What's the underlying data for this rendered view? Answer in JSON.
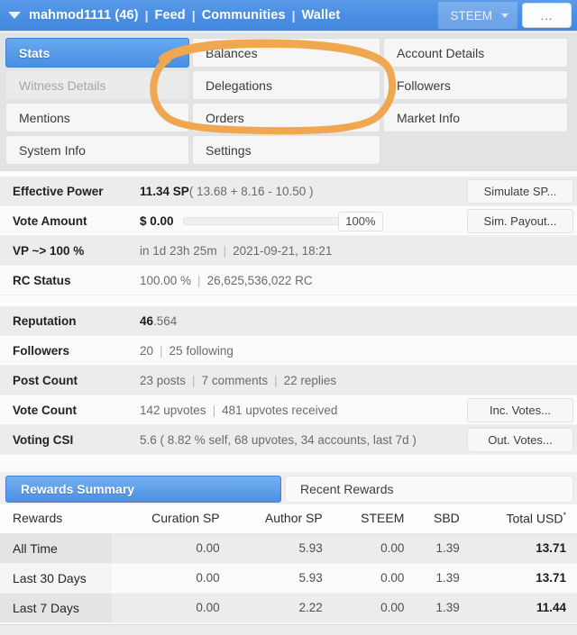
{
  "navbar": {
    "caret_icon": "caret-down-icon",
    "username": "mahmod1111 (46)",
    "links": [
      "Feed",
      "Communities",
      "Wallet"
    ],
    "separator": "|",
    "currency": "STEEM",
    "currency_caret_icon": "caret-down-icon",
    "more_button": "...",
    "accent": "#4a8fe3"
  },
  "tabs": [
    {
      "label": "Stats",
      "state": "active"
    },
    {
      "label": "Balances",
      "state": "normal"
    },
    {
      "label": "Account Details",
      "state": "normal"
    },
    {
      "label": "Witness Details",
      "state": "disabled"
    },
    {
      "label": "Delegations",
      "state": "normal"
    },
    {
      "label": "Followers",
      "state": "normal"
    },
    {
      "label": "Mentions",
      "state": "normal"
    },
    {
      "label": "Orders",
      "state": "normal"
    },
    {
      "label": "Market Info",
      "state": "normal"
    },
    {
      "label": "System Info",
      "state": "normal"
    },
    {
      "label": "Settings",
      "state": "normal"
    },
    {
      "label": "",
      "state": "empty"
    }
  ],
  "annotation": {
    "shape": "hand-drawn-ellipse",
    "color": "#f0a850"
  },
  "stats_group_1": [
    {
      "label": "Effective Power",
      "value_bold": "11.34 SP",
      "value_rest": " ( 13.68 + 8.16 - 10.50 )",
      "button": "Simulate SP..."
    },
    {
      "label": "Vote Amount",
      "value_bold": "$ 0.00",
      "value_rest": "",
      "slider_value": "100%",
      "button": "Sim. Payout..."
    },
    {
      "label": "VP ~> 100 %",
      "value_bold": "",
      "value_rest": "in 1d 23h 25m",
      "value_second": "2021-09-21, 18:21",
      "button": ""
    },
    {
      "label": "RC Status",
      "value_bold": "",
      "value_rest": "100.00 %",
      "value_second": "26,625,536,022 RC",
      "button": ""
    }
  ],
  "stats_group_2": [
    {
      "label": "Reputation",
      "value_bold": "46",
      "value_rest": ".564",
      "button": ""
    },
    {
      "label": "Followers",
      "value_rest": "20",
      "value_second": "25 following",
      "button": ""
    },
    {
      "label": "Post Count",
      "value_rest": "23 posts",
      "value_second": "7 comments",
      "value_third": "22 replies",
      "button": ""
    },
    {
      "label": "Vote Count",
      "value_rest": "142 upvotes",
      "value_second": "481 upvotes received",
      "button": "Inc. Votes..."
    },
    {
      "label": "Voting CSI",
      "value_rest": "5.6 ( 8.82 % self, 68 upvotes, 34 accounts, last 7d )",
      "button": "Out. Votes..."
    }
  ],
  "rewards": {
    "tab_active": "Rewards Summary",
    "tab_idle": "Recent Rewards",
    "headers": [
      "Rewards",
      "Curation SP",
      "Author SP",
      "STEEM",
      "SBD",
      "Total USD"
    ],
    "total_header_superscript": "*",
    "rows": [
      {
        "period": "All Time",
        "curation_sp": "0.00",
        "author_sp": "5.93",
        "steem": "0.00",
        "sbd": "1.39",
        "total_usd": "13.71"
      },
      {
        "period": "Last 30 Days",
        "curation_sp": "0.00",
        "author_sp": "5.93",
        "steem": "0.00",
        "sbd": "1.39",
        "total_usd": "13.71"
      },
      {
        "period": "Last 7 Days",
        "curation_sp": "0.00",
        "author_sp": "2.22",
        "steem": "0.00",
        "sbd": "1.39",
        "total_usd": "11.44"
      }
    ]
  }
}
